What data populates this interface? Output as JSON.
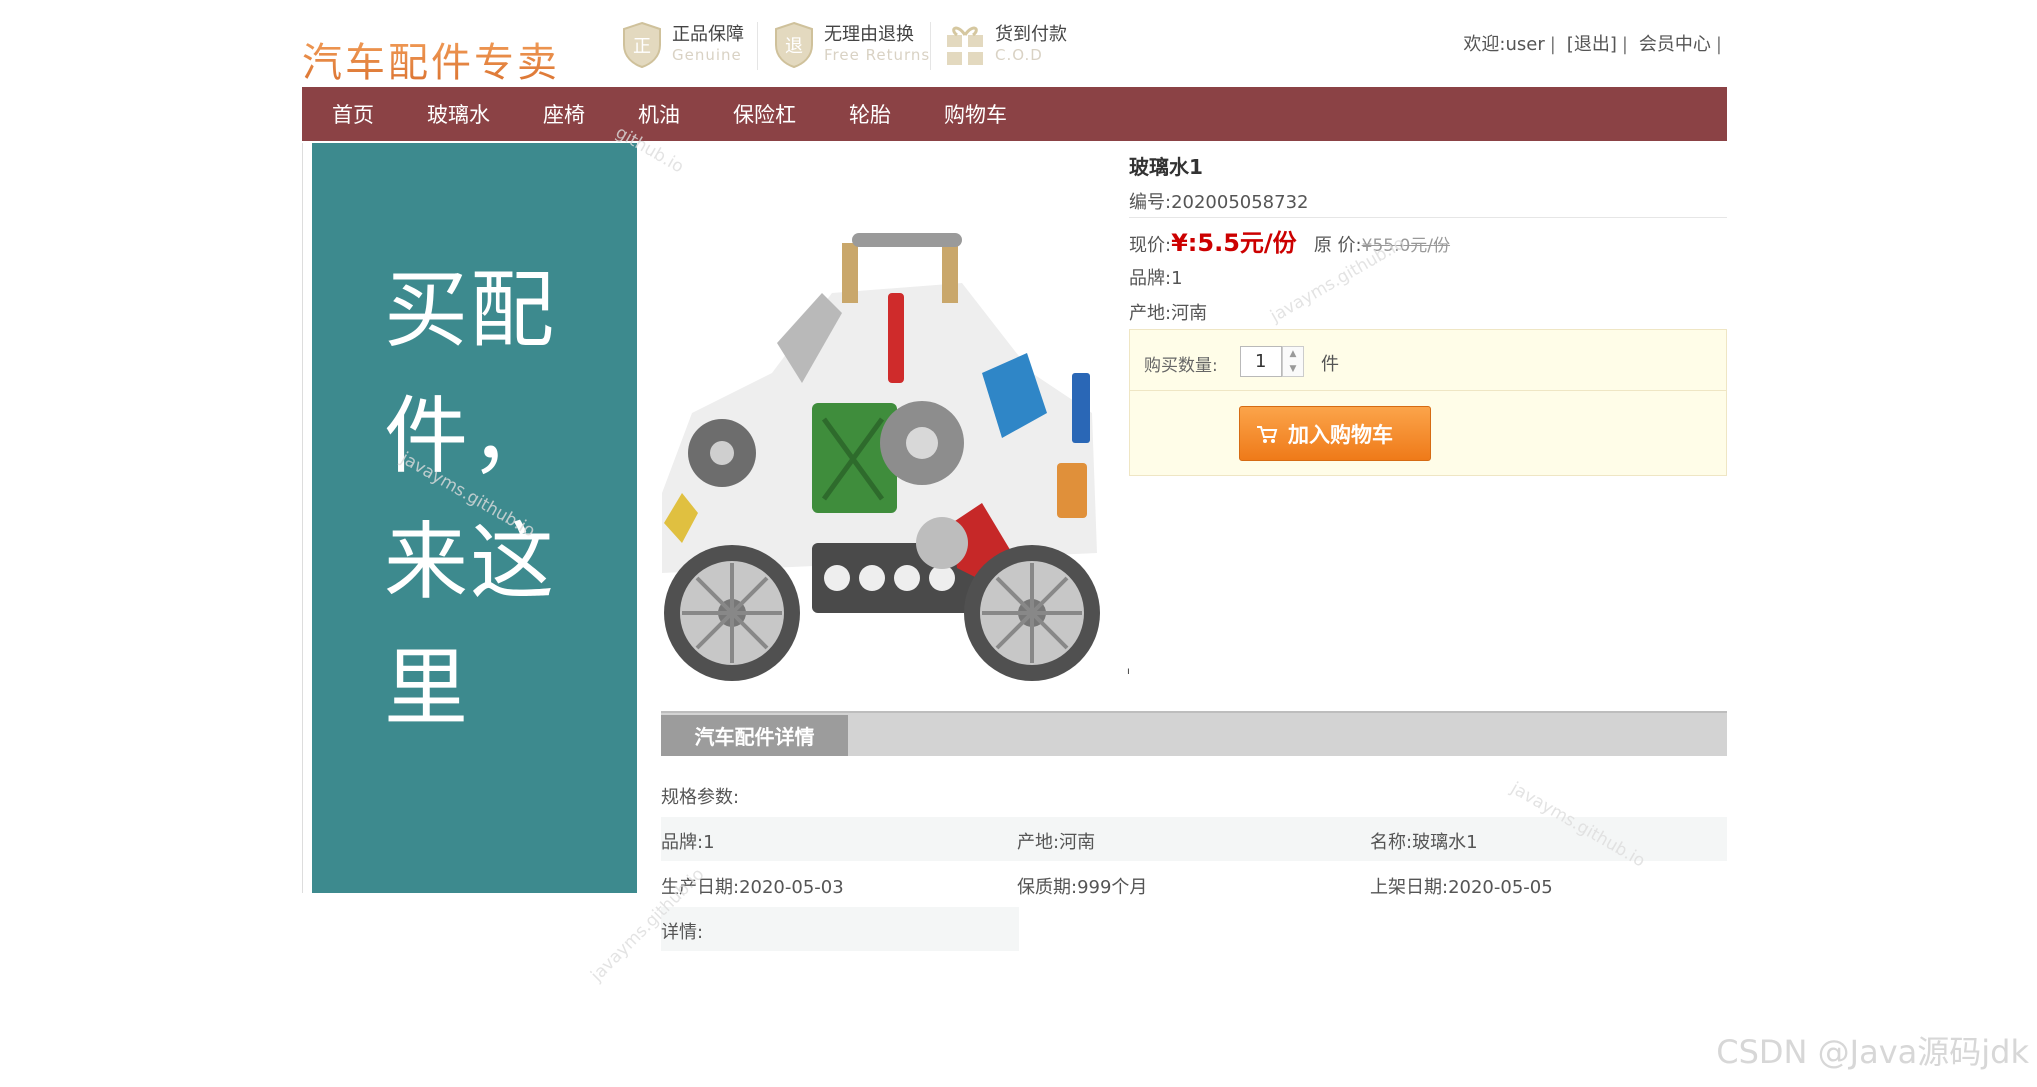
{
  "header": {
    "logo": "汽车配件专卖",
    "badges": [
      {
        "title": "正品保障",
        "subtitle": "Genuine",
        "icon": "shield-genuine-icon"
      },
      {
        "title": "无理由退换",
        "subtitle": "Free Returns",
        "icon": "shield-return-icon"
      },
      {
        "title": "货到付款",
        "subtitle": "C.O.D",
        "icon": "gift-cod-icon"
      }
    ],
    "user": {
      "welcome": "欢迎:user",
      "logout": "[退出]",
      "member_center": "会员中心",
      "sep": "|"
    }
  },
  "nav": {
    "items": [
      "首页",
      "玻璃水",
      "座椅",
      "机油",
      "保险杠",
      "轮胎",
      "购物车"
    ]
  },
  "sidebar": {
    "slogan": "买配件，来这里"
  },
  "product": {
    "name": "玻璃水1",
    "code": "编号:202005058732",
    "price_label": "现价:",
    "price_now": "¥:5.5元/份",
    "orig_label": "原 价:",
    "price_orig": "¥55.0元/份",
    "brand": "品牌:1",
    "origin": "产地:河南"
  },
  "buy": {
    "qty_label": "购买数量:",
    "qty_value": "1",
    "unit": "件",
    "add_cart": "加入购物车"
  },
  "misc": {
    "tick": "ı"
  },
  "details": {
    "tab": "汽车配件详情",
    "spec_title": "规格参数:",
    "rows": [
      [
        "品牌:1",
        "产地:河南",
        "名称:玻璃水1"
      ],
      [
        "生产日期:2020-05-03",
        "保质期:999个月",
        "上架日期:2020-05-05"
      ]
    ],
    "detail_label": "详情:"
  },
  "watermarks": {
    "site": "javayms.github.io",
    "partial": "github.io",
    "credit": "CSDN @Java源码jdk"
  },
  "colors": {
    "nav_bg": "#8b4245",
    "sidebar_bg": "#3d8a8e",
    "price": "#cc0000",
    "button": "#ef7a19"
  }
}
